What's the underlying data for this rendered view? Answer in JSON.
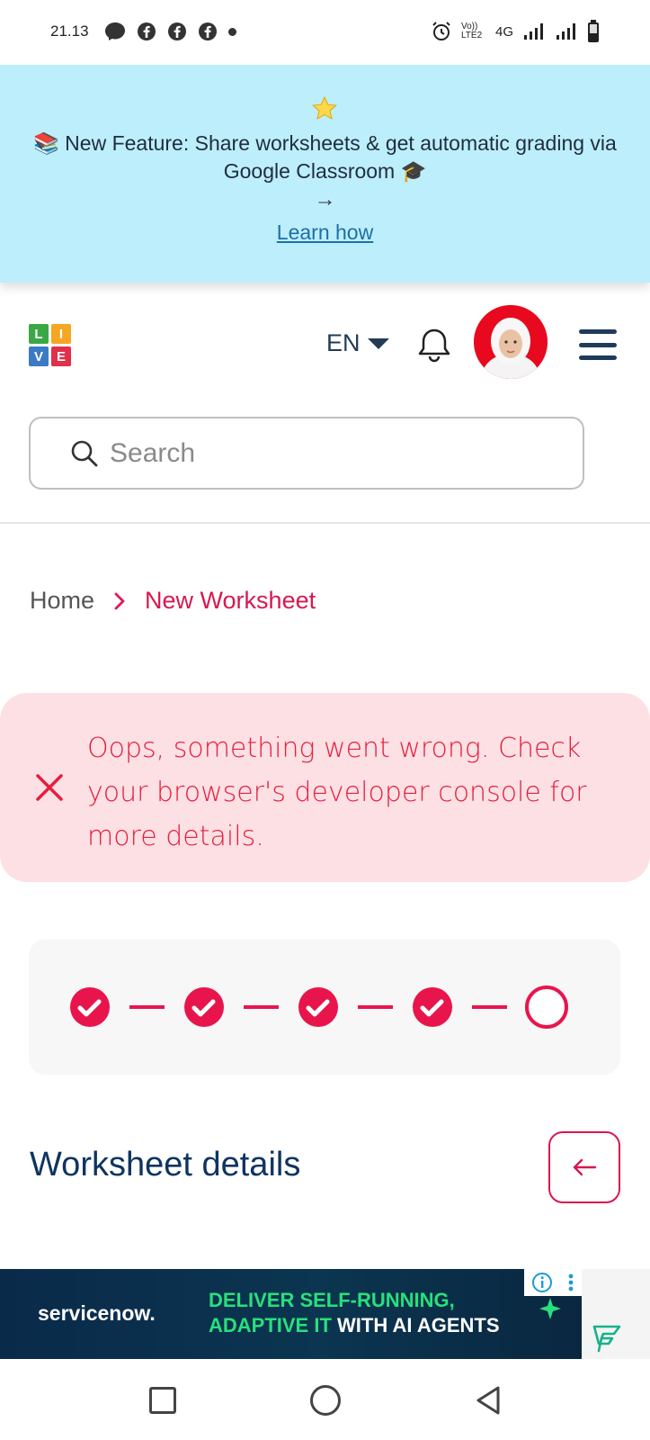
{
  "status_bar": {
    "time": "21.13",
    "network": "4G",
    "volte": "Vo)) LTE2"
  },
  "banner": {
    "text": "📚 New Feature: Share worksheets & get automatic grading via Google Classroom 🎓",
    "arrow": "→",
    "link": "Learn how",
    "star_icon": "star-icon"
  },
  "header": {
    "logo_letters": [
      "L",
      "I",
      "V",
      "E"
    ],
    "logo_colors": [
      "#3aa845",
      "#f5a623",
      "#3b7ac4",
      "#e0304a"
    ],
    "language": "EN"
  },
  "search": {
    "placeholder": "Search"
  },
  "breadcrumb": {
    "home": "Home",
    "separator": ">",
    "current": "New Worksheet"
  },
  "alert": {
    "message": "Oops, something went wrong. Check your browser's developer console for more details."
  },
  "stepper": {
    "total_steps": 5,
    "completed_steps": 4,
    "accent": "#e8154d"
  },
  "section": {
    "title": "Worksheet details",
    "back_icon": "arrow-left-icon"
  },
  "ad": {
    "brand": "servicenow.",
    "line1": "DELIVER SELF-RUNNING,",
    "line2_green": "ADAPTIVE IT",
    "line2_white": " WITH AI AGENTS"
  },
  "colors": {
    "banner_bg": "#bdeefb",
    "alert_bg": "#fde0e4",
    "alert_text": "#e61e3d",
    "brand_pink": "#d9174f",
    "title_navy": "#0f3461"
  }
}
